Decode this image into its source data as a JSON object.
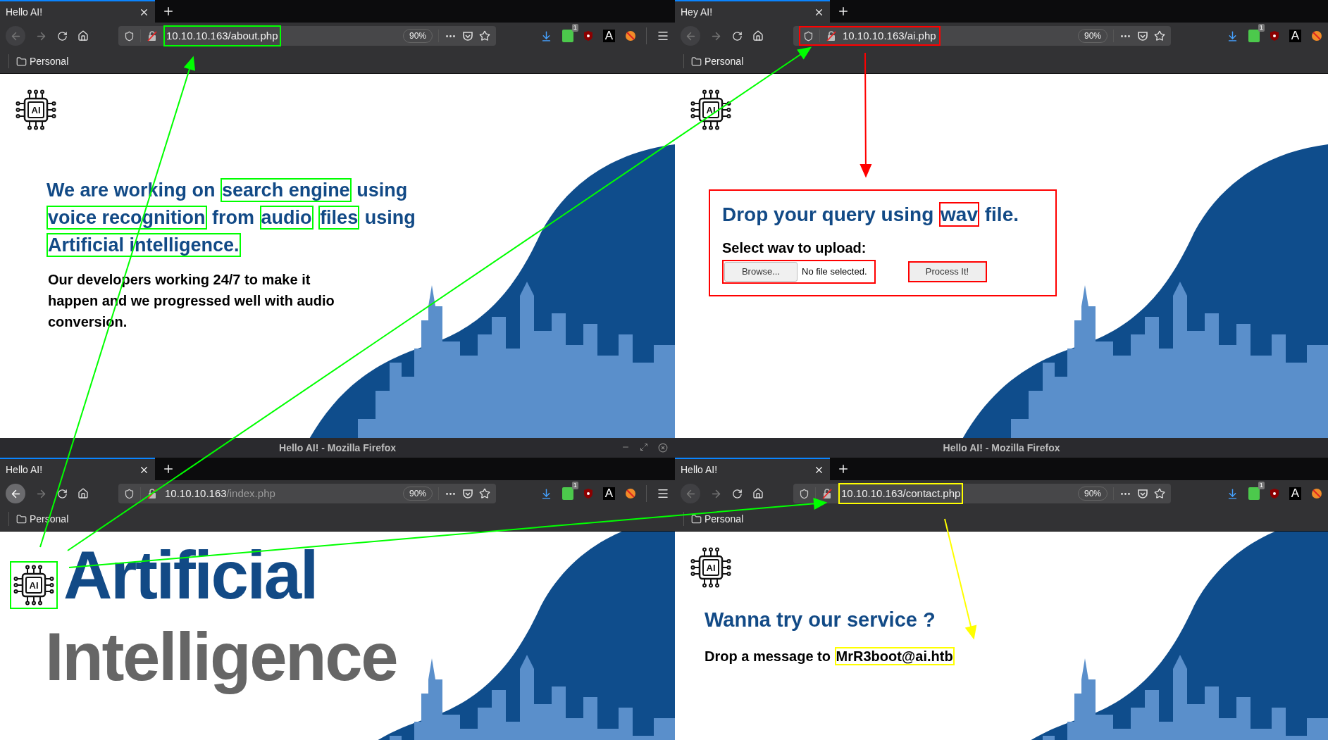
{
  "windows": [
    {
      "tab": {
        "label": "Hello AI!",
        "selected": true
      },
      "back_enabled": false,
      "url": {
        "host": "10.10.10.163",
        "path": "/about.php",
        "path_dimmed": false,
        "highlight": {
          "color": "#00ff00",
          "covers_icons": false
        }
      },
      "zoom": "90%",
      "extension_badge": "1",
      "extension_letter": "A",
      "menu_visible": true,
      "bookmark": "Personal",
      "logo": {
        "text": "AI"
      },
      "page": {
        "kind": "about",
        "heading": [
          {
            "text": "We are working on "
          },
          {
            "text": "search engine",
            "highlight": {
              "color": "#00ff00"
            }
          },
          {
            "text": " using "
          },
          {
            "text": "voice recognition",
            "highlight": {
              "color": "#00ff00"
            }
          },
          {
            "text": " from "
          },
          {
            "text": "audio",
            "highlight": {
              "color": "#00ff00"
            }
          },
          {
            "text": "files",
            "highlight": {
              "color": "#00ff00"
            }
          },
          {
            "text": " using "
          },
          {
            "text": "Artificial intelligence.",
            "highlight": {
              "color": "#00ff00"
            }
          }
        ],
        "paragraph": "Our developers working 24/7 to make it happen and we progressed well with audio conversion."
      }
    },
    {
      "tab": {
        "label": "Hey AI!",
        "selected": true
      },
      "back_enabled": false,
      "url": {
        "host": "10.10.10.163",
        "path": "/ai.php",
        "path_dimmed": false,
        "highlight": {
          "color": "#ff0000",
          "covers_icons": true
        }
      },
      "zoom": "90%",
      "extension_badge": "1",
      "extension_letter": "A",
      "menu_visible": false,
      "bookmark": "Personal",
      "logo": {
        "text": "AI"
      },
      "page": {
        "kind": "upload",
        "frame": {
          "color": "#ff0000"
        },
        "heading": [
          {
            "text": "Drop your query using "
          },
          {
            "text": "wav",
            "highlight": {
              "color": "#ff0000"
            }
          },
          {
            "text": " file."
          }
        ],
        "label": "Select wav to upload:",
        "browse": "Browse...",
        "file_status": "No file selected.",
        "picker_highlight": {
          "color": "#ff0000"
        },
        "submit": "Process It!",
        "submit_highlight": {
          "color": "#ff0000"
        }
      }
    },
    {
      "title": "Hello AI! - Mozilla Firefox",
      "tab": {
        "label": "Hello AI!",
        "selected": true
      },
      "back_enabled": true,
      "url": {
        "host": "10.10.10.163",
        "path": "/index.php",
        "path_dimmed": true
      },
      "zoom": "90%",
      "extension_badge": "1",
      "extension_letter": "A",
      "menu_visible": true,
      "bookmark": "Personal",
      "logo": {
        "text": "AI",
        "highlight": {
          "color": "#00ff00"
        }
      },
      "page": {
        "kind": "home",
        "line1": "Artificial",
        "line2": "Intelligence"
      }
    },
    {
      "title": "Hello AI! - Mozilla Firefox",
      "tab": {
        "label": "Hello AI!",
        "selected": true
      },
      "back_enabled": false,
      "url": {
        "host": "10.10.10.163",
        "path": "/contact.php",
        "path_dimmed": false,
        "highlight": {
          "color": "#ffff00",
          "covers_icons": false
        }
      },
      "zoom": "90%",
      "extension_badge": "1",
      "extension_letter": "A",
      "menu_visible": false,
      "bookmark": "Personal",
      "logo": {
        "text": "AI"
      },
      "page": {
        "kind": "contact",
        "heading": "Wanna try our service ?",
        "message": [
          {
            "text": "Drop a message to "
          },
          {
            "text": "MrR3boot@ai.htb",
            "highlight": {
              "color": "#ffff00"
            }
          }
        ]
      }
    }
  ]
}
